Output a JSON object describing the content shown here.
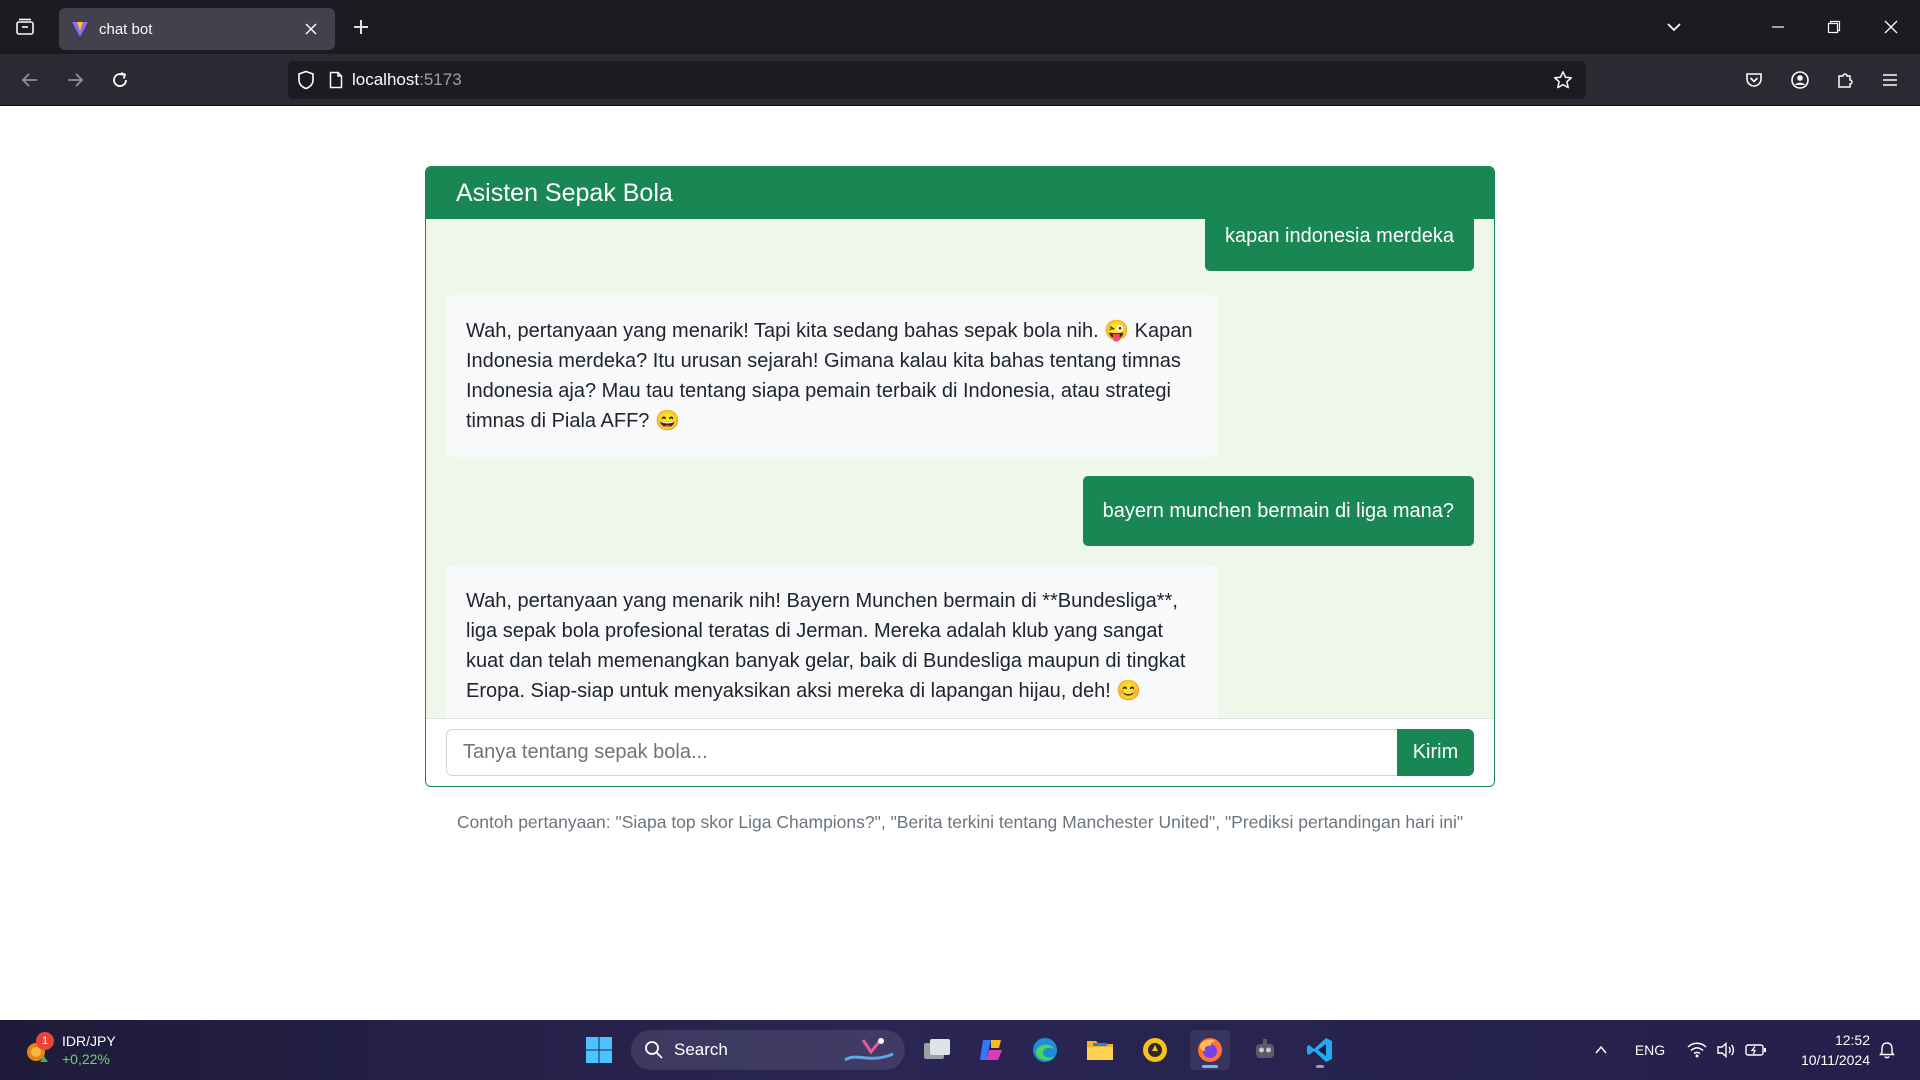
{
  "browser": {
    "tab_title": "chat bot",
    "url_host": "localhost",
    "url_port": ":5173"
  },
  "chat": {
    "header_title": "Asisten Sepak Bola",
    "messages": [
      {
        "role": "user",
        "text": "kapan indonesia merdeka"
      },
      {
        "role": "bot",
        "text": "Wah, pertanyaan yang menarik! Tapi kita sedang bahas sepak bola nih. 😜 Kapan Indonesia merdeka? Itu urusan sejarah! Gimana kalau kita bahas tentang timnas Indonesia aja? Mau tau tentang siapa pemain terbaik di Indonesia, atau strategi timnas di Piala AFF? 😄"
      },
      {
        "role": "user",
        "text": "bayern munchen bermain di liga mana?"
      },
      {
        "role": "bot",
        "text": "Wah, pertanyaan yang menarik nih! Bayern Munchen bermain di **Bundesliga**, liga sepak bola profesional teratas di Jerman. Mereka adalah klub yang sangat kuat dan telah memenangkan banyak gelar, baik di Bundesliga maupun di tingkat Eropa. Siap-siap untuk menyaksikan aksi mereka di lapangan hijau, deh! 😊"
      }
    ],
    "input_placeholder": "Tanya tentang sepak bola...",
    "input_value": "",
    "send_label": "Kirim",
    "examples_text": "Contoh pertanyaan: \"Siapa top skor Liga Champions?\", \"Berita terkini tentang Manchester United\", \"Prediksi pertandingan hari ini\""
  },
  "taskbar": {
    "widget_title": "IDR/JPY",
    "widget_change": "+0,22%",
    "widget_badge": "1",
    "search_label": "Search",
    "language": "ENG",
    "time": "12:52",
    "date": "10/11/2024"
  },
  "colors": {
    "primary": "#198754",
    "chat_background": "#eef7ea",
    "bot_bubble": "#f8f9fa"
  }
}
